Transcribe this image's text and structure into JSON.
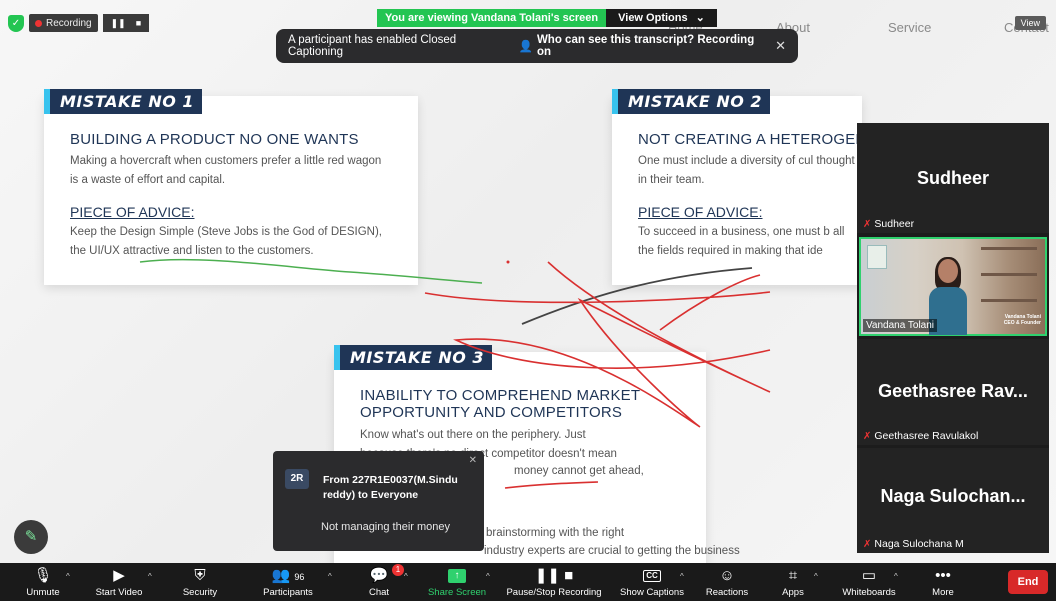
{
  "banner": {
    "viewing_text": "You are viewing Vandana Tolani's screen",
    "view_options_label": "View Options"
  },
  "recording": {
    "label": "Recording",
    "pause_icon": "pause-icon",
    "stop_icon": "stop-icon"
  },
  "cc_toast": {
    "message": "A participant has enabled Closed Captioning",
    "who_label": "Who can see this transcript? Recording on"
  },
  "view_button": {
    "label": "View"
  },
  "slide": {
    "nav": [
      "Home",
      "About",
      "Service",
      "Contact"
    ],
    "card1": {
      "badge": "MISTAKE NO 1",
      "title": "BUILDING A PRODUCT NO ONE WANTS",
      "body": "Making a hovercraft when customers prefer a little red wagon is a waste of effort and capital.",
      "advice_heading": "PIECE OF ADVICE:",
      "advice": "Keep the Design Simple (Steve Jobs is the God of DESIGN), the UI/UX attractive and listen to the customers."
    },
    "card2": {
      "badge": "MISTAKE NO 2",
      "title": "NOT CREATING A HETEROGEN",
      "body": "One must include a diversity of cul thought in their team.",
      "advice_heading": "PIECE OF ADVICE:",
      "advice": "To succeed in a business, one must b all the fields required in making that ide"
    },
    "card3": {
      "badge": "MISTAKE NO 3",
      "title": "INABILITY TO COMPREHEND MARKET OPPORTUNITY AND COMPETITORS",
      "body_line1": "Know what's out there on the periphery. Just",
      "body_line2": "because there's no direct competitor doesn't mean",
      "body_line3": "money cannot get ahead,",
      "advice_heading": "E:",
      "advice_line1": "brainstorming with the right",
      "advice_line2": "industry experts are crucial to getting the business"
    }
  },
  "participants": [
    {
      "big_name": "Sudheer",
      "small_name": "Sudheer",
      "muted": true
    },
    {
      "video_name": "Vandana Tolani",
      "lower_third_name": "Vandana Tolani",
      "lower_third_role": "CEO & Founder"
    },
    {
      "big_name": "Geethasree  Rav...",
      "small_name": "Geethasree Ravulakol",
      "muted": true
    },
    {
      "big_name": "Naga  Sulochan...",
      "small_name": "Naga Sulochana M",
      "muted": true
    }
  ],
  "chat_toast": {
    "avatar": "2R",
    "from": "From 227R1E0037(M.Sindu reddy) to Everyone",
    "message": "Not managing their money"
  },
  "toolbar": {
    "unmute": "Unmute",
    "start_video": "Start Video",
    "security": "Security",
    "participants_count": "96",
    "participants": "Participants",
    "chat": "Chat",
    "chat_badge": "1",
    "share_screen": "Share Screen",
    "pause_stop_recording": "Pause/Stop Recording",
    "cc": "CC",
    "show_captions": "Show Captions",
    "reactions": "Reactions",
    "apps": "Apps",
    "whiteboards": "Whiteboards",
    "more": "More",
    "end": "End"
  },
  "colors": {
    "accent_green": "#23c552",
    "end_red": "#d82929",
    "slide_navy": "#1f3556",
    "badge_cyan": "#38c3ee",
    "annotation_red": "#d93030",
    "annotation_dark": "#444444",
    "annotation_green": "#4caf50"
  }
}
